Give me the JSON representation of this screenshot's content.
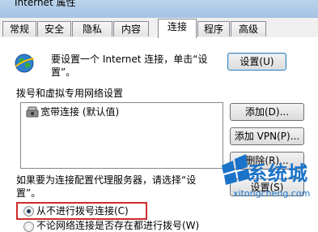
{
  "window": {
    "title": "Internet 属性"
  },
  "tabs": [
    {
      "label": "常规"
    },
    {
      "label": "安全"
    },
    {
      "label": "隐私"
    },
    {
      "label": "内容"
    },
    {
      "label": "连接"
    },
    {
      "label": "程序"
    },
    {
      "label": "高级"
    }
  ],
  "active_tab": "连接",
  "setup": {
    "text_line1": "要设置一个 Internet 连接，单击“设",
    "text_line2": "置”。",
    "button": "设置(U)"
  },
  "dialup": {
    "section_label": "拨号和虚拟专用网络设置",
    "connections": [
      {
        "label": "宽带连接 (默认值)"
      }
    ],
    "add_button": "添加(D)...",
    "add_vpn_button": "添加 VPN(P)...",
    "delete_button": "删除(R)...",
    "proxy_text_line1": "如果要为连接配置代理服务器，请选择“设",
    "proxy_text_line2": "置”。",
    "settings_button": "设置(S)",
    "radio_never": "从不进行拨号连接(C)",
    "radio_whenever": "不论网络连接是否存在都进行拨号(W)",
    "selected_radio": "never"
  },
  "watermark": {
    "name": "系统城",
    "url": "xitongcheng.com"
  },
  "colors": {
    "highlight": "#d22b2b",
    "watermark": "#1a73c9"
  }
}
